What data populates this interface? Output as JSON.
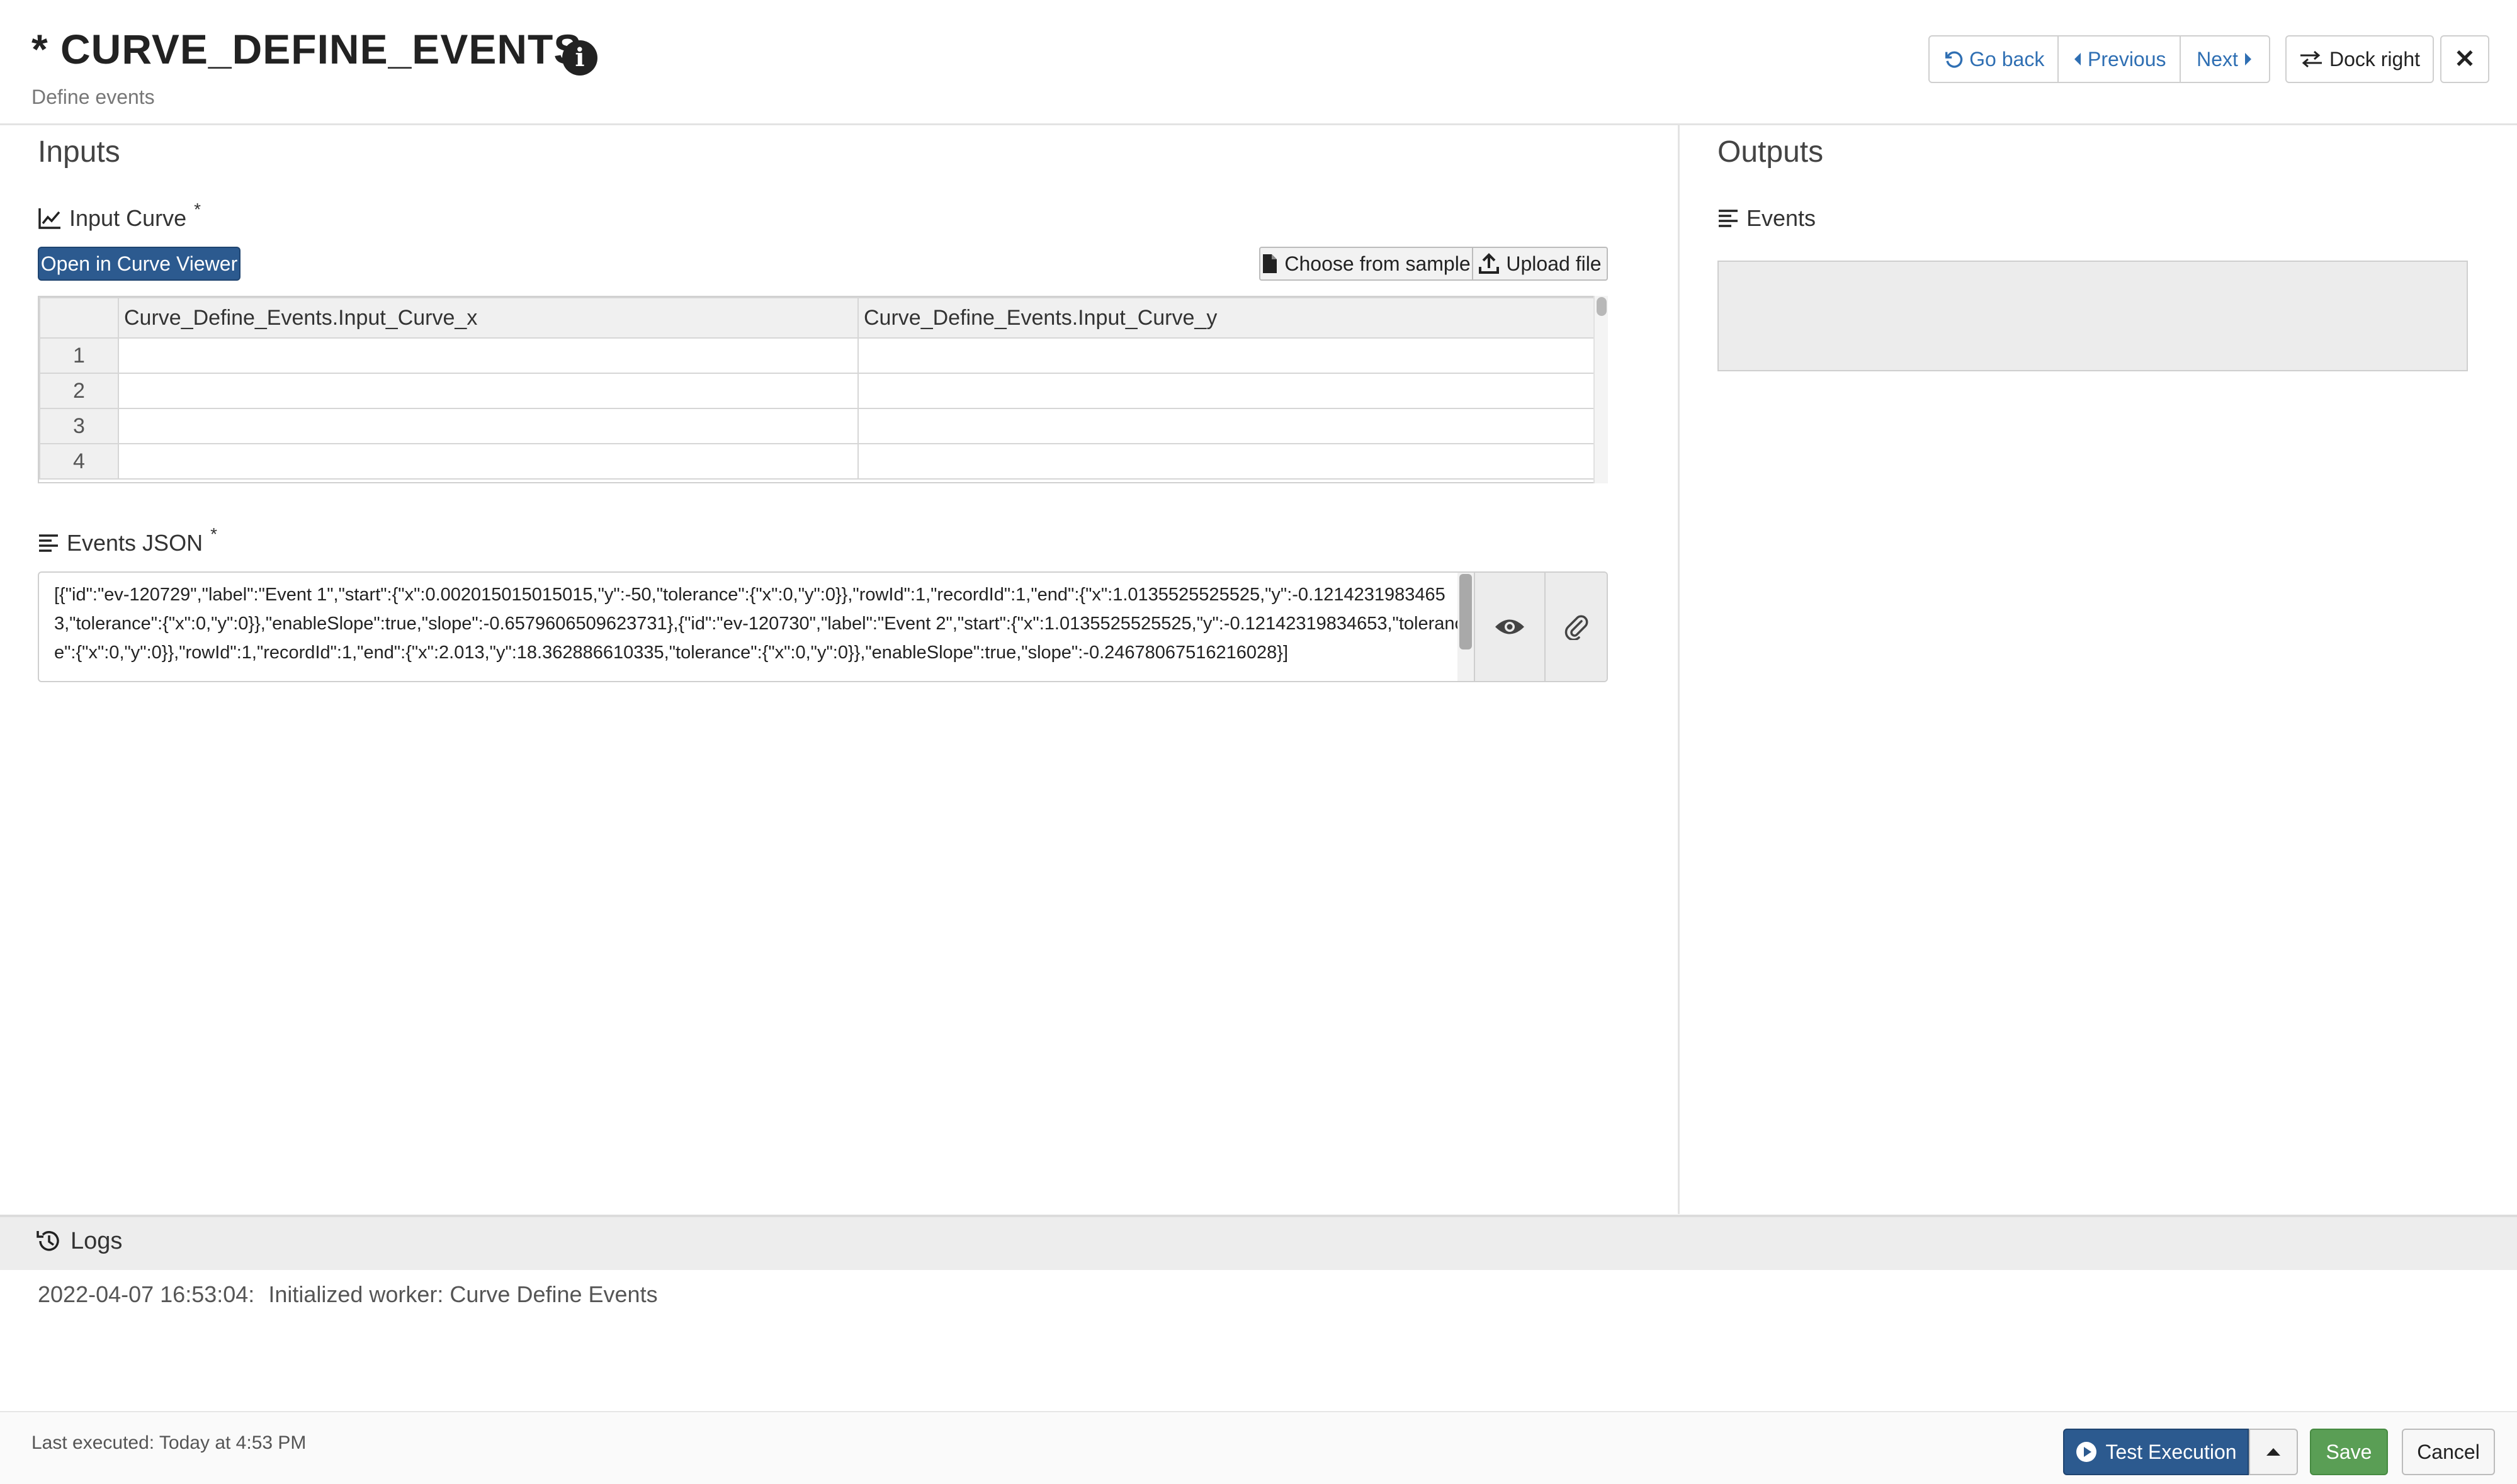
{
  "header": {
    "title": "* CURVE_DEFINE_EVENTS",
    "subtitle": "Define events",
    "go_back": "Go back",
    "previous": "Previous",
    "next": "Next",
    "dock_right": "Dock right",
    "close": "✕"
  },
  "inputs": {
    "heading": "Inputs",
    "input_curve": {
      "label": "Input Curve",
      "required_mark": "*",
      "open_viewer": "Open in Curve Viewer",
      "choose_sample": "Choose from sample",
      "upload_file": "Upload file",
      "columns": [
        "Curve_Define_Events.Input_Curve_x",
        "Curve_Define_Events.Input_Curve_y"
      ],
      "rows": [
        {
          "num": "1"
        },
        {
          "num": "2"
        },
        {
          "num": "3"
        },
        {
          "num": "4"
        }
      ]
    },
    "events_json": {
      "label": "Events JSON",
      "required_mark": "*",
      "value": "[{\"id\":\"ev-120729\",\"label\":\"Event 1\",\"start\":{\"x\":0.002015015015015,\"y\":-50,\"tolerance\":{\"x\":0,\"y\":0}},\"rowId\":1,\"recordId\":1,\"end\":{\"x\":1.0135525525525,\"y\":-0.12142319834653,\"tolerance\":{\"x\":0,\"y\":0}},\"enableSlope\":true,\"slope\":-0.6579606509623731},{\"id\":\"ev-120730\",\"label\":\"Event 2\",\"start\":{\"x\":1.0135525525525,\"y\":-0.12142319834653,\"tolerance\":{\"x\":0,\"y\":0}},\"rowId\":1,\"recordId\":1,\"end\":{\"x\":2.013,\"y\":18.362886610335,\"tolerance\":{\"x\":0,\"y\":0}},\"enableSlope\":true,\"slope\":-0.24678067516216028}]"
    }
  },
  "outputs": {
    "heading": "Outputs",
    "events_label": "Events"
  },
  "logs": {
    "heading": "Logs",
    "entries": [
      {
        "time": "2022-04-07 16:53:04:",
        "message": "Initialized worker: Curve Define Events"
      }
    ]
  },
  "footer": {
    "last_executed": "Last executed: Today at 4:53 PM",
    "test_execution": "Test Execution",
    "save": "Save",
    "cancel": "Cancel"
  },
  "colors": {
    "primary": "#2c5a8f",
    "link": "#2f6fb3",
    "success": "#5a9e55"
  }
}
